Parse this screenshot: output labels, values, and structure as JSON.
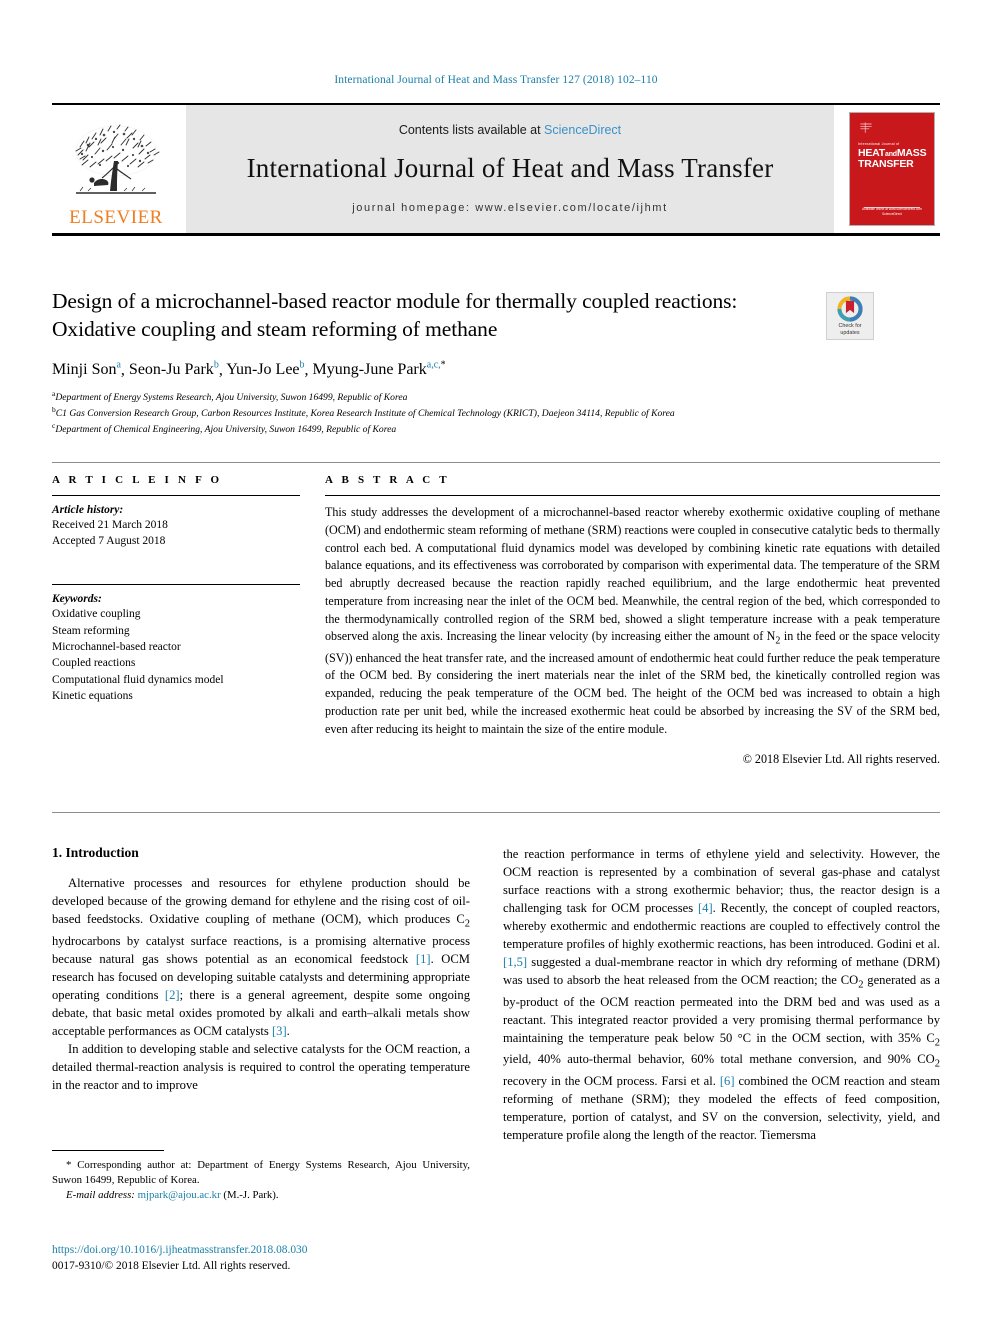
{
  "running_head": "International Journal of Heat and Mass Transfer 127 (2018) 102–110",
  "masthead": {
    "publisher": "ELSEVIER",
    "contents_prefix": "Contents lists available at ",
    "contents_link": "ScienceDirect",
    "journal_title": "International Journal of Heat and Mass Transfer",
    "homepage": "journal homepage: www.elsevier.com/locate/ijhmt",
    "cover": {
      "sub": "International Journal of",
      "line1": "HEAT",
      "and": "and",
      "line2": "MASS",
      "line3": "TRANSFER",
      "footer1": "Available online at www.sciencedirect.com",
      "footer2": "ScienceDirect"
    }
  },
  "article": {
    "title": "Design of a microchannel-based reactor module for thermally coupled reactions: Oxidative coupling and steam reforming of methane",
    "authors": [
      {
        "name": "Minji Son",
        "sup": "a",
        "sep": ", "
      },
      {
        "name": "Seon-Ju Park",
        "sup": "b",
        "sep": ", "
      },
      {
        "name": "Yun-Jo Lee",
        "sup": "b",
        "sep": ", "
      },
      {
        "name": "Myung-June Park",
        "sup": "a,c,",
        "asterisk": "*",
        "sep": ""
      }
    ],
    "affiliations": [
      {
        "marker": "a",
        "text": "Department of Energy Systems Research, Ajou University, Suwon 16499, Republic of Korea"
      },
      {
        "marker": "b",
        "text": "C1 Gas Conversion Research Group, Carbon Resources Institute, Korea Research Institute of Chemical Technology (KRICT), Daejeon 34114, Republic of Korea"
      },
      {
        "marker": "c",
        "text": "Department of Chemical Engineering, Ajou University, Suwon 16499, Republic of Korea"
      }
    ]
  },
  "crossmark": {
    "line1": "Check for",
    "line2": "updates"
  },
  "article_info": {
    "heading": "A R T I C L E   I N F O",
    "history_label": "Article history:",
    "history": [
      "Received 21 March 2018",
      "Accepted 7 August 2018"
    ],
    "keywords_label": "Keywords:",
    "keywords": [
      "Oxidative coupling",
      "Steam reforming",
      "Microchannel-based reactor",
      "Coupled reactions",
      "Computational fluid dynamics model",
      "Kinetic equations"
    ]
  },
  "abstract": {
    "heading": "A B S T R A C T",
    "text": "This study addresses the development of a microchannel-based reactor whereby exothermic oxidative coupling of methane (OCM) and endothermic steam reforming of methane (SRM) reactions were coupled in consecutive catalytic beds to thermally control each bed. A computational fluid dynamics model was developed by combining kinetic rate equations with detailed balance equations, and its effectiveness was corroborated by comparison with experimental data. The temperature of the SRM bed abruptly decreased because the reaction rapidly reached equilibrium, and the large endothermic heat prevented temperature from increasing near the inlet of the OCM bed. Meanwhile, the central region of the bed, which corresponded to the thermodynamically controlled region of the SRM bed, showed a slight temperature increase with a peak temperature observed along the axis. Increasing the linear velocity (by increasing either the amount of N2 in the feed or the space velocity (SV)) enhanced the heat transfer rate, and the increased amount of endothermic heat could further reduce the peak temperature of the OCM bed. By considering the inert materials near the inlet of the SRM bed, the kinetically controlled region was expanded, reducing the peak temperature of the OCM bed. The height of the OCM bed was increased to obtain a high production rate per unit bed, while the increased exothermic heat could be absorbed by increasing the SV of the SRM bed, even after reducing its height to maintain the size of the entire module.",
    "copyright": "© 2018 Elsevier Ltd. All rights reserved."
  },
  "introduction": {
    "heading": "1. Introduction",
    "left_paragraphs": [
      "Alternative processes and resources for ethylene production should be developed because of the growing demand for ethylene and the rising cost of oil-based feedstocks. Oxidative coupling of methane (OCM), which produces C2 hydrocarbons by catalyst surface reactions, is a promising alternative process because natural gas shows potential as an economical feedstock [1]. OCM research has focused on developing suitable catalysts and determining appropriate operating conditions [2]; there is a general agreement, despite some ongoing debate, that basic metal oxides promoted by alkali and earth–alkali metals show acceptable performances as OCM catalysts [3].",
      "In addition to developing stable and selective catalysts for the OCM reaction, a detailed thermal-reaction analysis is required to control the operating temperature in the reactor and to improve"
    ],
    "right_paragraphs": [
      "the reaction performance in terms of ethylene yield and selectivity. However, the OCM reaction is represented by a combination of several gas-phase and catalyst surface reactions with a strong exothermic behavior; thus, the reactor design is a challenging task for OCM processes [4]. Recently, the concept of coupled reactors, whereby exothermic and endothermic reactions are coupled to effectively control the temperature profiles of highly exothermic reactions, has been introduced. Godini et al. [1,5] suggested a dual-membrane reactor in which dry reforming of methane (DRM) was used to absorb the heat released from the OCM reaction; the CO2 generated as a by-product of the OCM reaction permeated into the DRM bed and was used as a reactant. This integrated reactor provided a very promising thermal performance by maintaining the temperature peak below 50 °C in the OCM section, with 35% C2 yield, 40% auto-thermal behavior, 60% total methane conversion, and 90% CO2 recovery in the OCM process. Farsi et al. [6] combined the OCM reaction and steam reforming of methane (SRM); they modeled the effects of feed composition, temperature, portion of catalyst, and SV on the conversion, selectivity, yield, and temperature profile along the length of the reactor. Tiemersma"
    ]
  },
  "footnote": {
    "corresponding": "* Corresponding author at: Department of Energy Systems Research, Ajou University, Suwon 16499, Republic of Korea.",
    "email_label": "E-mail address:",
    "email": "mjpark@ajou.ac.kr",
    "email_owner": "(M.-J. Park)."
  },
  "footer": {
    "doi": "https://doi.org/10.1016/j.ijheatmasstransfer.2018.08.030",
    "issn_line": "0017-9310/© 2018 Elsevier Ltd. All rights reserved."
  },
  "colors": {
    "link": "#1a7fa8",
    "elsevier_orange": "#ef7d22",
    "cover_red": "#c8181b",
    "sciencedirect": "#3a92c8"
  }
}
